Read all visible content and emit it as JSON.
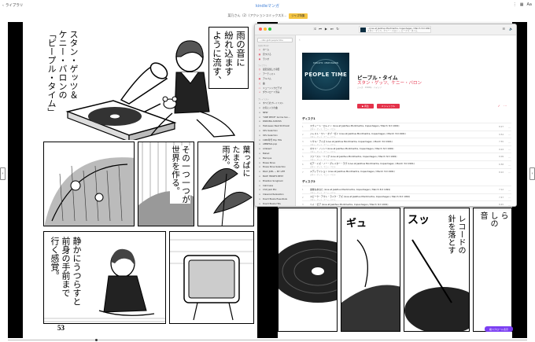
{
  "topbar": {
    "library_icon": "chevron-left-icon",
    "library_label": "ライブラリ",
    "brand": "kindleマンガ",
    "right_icons": [
      "vertical-dots-icon",
      "grid-icon",
      "font-size-icon"
    ],
    "font_label": "Aa"
  },
  "titlebar": {
    "book_title": "菜乃さん（2）(アクションコミックス)(...",
    "tag_label": "ジャズ特集"
  },
  "book": {
    "page_number": "53",
    "left_bubble_top": [
      "雨の音に",
      "紛れ込ます",
      "ように流す、"
    ],
    "left_bubble_caption": [
      "スタン・ゲッツ＆",
      "ケニー・バロンの",
      "「ピープル・タイム」"
    ],
    "mid_text_a": [
      "葉っぱに",
      "たまる",
      "雨水。"
    ],
    "mid_text_b": [
      "その一つ一つが",
      "世界を作る。"
    ],
    "low_text": [
      "静かにうつらすと",
      "前身の手前まで",
      "行く感覚。"
    ],
    "right_text_a": [
      "レコードの",
      "針を落とす"
    ],
    "right_text_b": [
      "ら",
      "しの",
      "音"
    ],
    "sfx_a": "ギュ",
    "sfx_b": "スッ",
    "view_button": "縦スクロール表示"
  },
  "music": {
    "transport": [
      "shuffle-icon",
      "prev-icon",
      "play-icon",
      "next-icon",
      "repeat-icon"
    ],
    "now_playing_line1": "...(Live at Jazzhus Montmartre, Copenhagen / March 3rd 1991) / ピープル・タイム",
    "now_playing_line2": "スタン・ゲッツ、ケニー・バロン — ピープル・タイム",
    "header_right": [
      "list-icon",
      "speaker-icon"
    ],
    "search_placeholder": "stan getz people time",
    "sidebar_sections": [
      {
        "title": "Apple Music",
        "items": [
          {
            "icon": "home-icon",
            "label": "ホーム"
          },
          {
            "icon": "browse-icon",
            "label": "見つける"
          },
          {
            "icon": "radio-icon",
            "label": "ラジオ"
          }
        ]
      },
      {
        "title": "ライブラリ",
        "items": [
          {
            "icon": "clock-icon",
            "label": "最近追加した項目"
          },
          {
            "icon": "mic-icon",
            "label": "アーティスト"
          },
          {
            "icon": "album-icon",
            "label": "アルバム"
          },
          {
            "icon": "note-icon",
            "label": "曲"
          },
          {
            "icon": "tv-icon",
            "label": "ミュージックビデオ"
          },
          {
            "icon": "download-icon",
            "label": "ダウンロード済み"
          }
        ]
      },
      {
        "title": "プレイリスト",
        "items": [
          {
            "icon": "playlist-icon",
            "label": "すべてのプレイリスト"
          },
          {
            "icon": "playlist-icon",
            "label": "お気に入りの曲"
          },
          {
            "icon": "playlist-icon",
            "label": "NEW"
          },
          {
            "icon": "playlist-icon",
            "label": "\"ONE PIECE\" Anime Son..."
          },
          {
            "icon": "playlist-icon",
            "label": "PARKING ACROSS"
          },
          {
            "icon": "playlist-icon",
            "label": "Halloween Best Shitmosh"
          },
          {
            "icon": "playlist-icon",
            "label": "90's Selection"
          },
          {
            "icon": "playlist-icon",
            "label": "90's Selection"
          },
          {
            "icon": "playlist-icon",
            "label": "1980年代 Pop Hits"
          },
          {
            "icon": "playlist-icon",
            "label": "AMNESIA-pop"
          },
          {
            "icon": "playlist-icon",
            "label": "Ambient"
          },
          {
            "icon": "playlist-icon",
            "label": "Ballad"
          },
          {
            "icon": "playlist-icon",
            "label": "Baroque"
          },
          {
            "icon": "playlist-icon",
            "label": "Bossa Nova"
          },
          {
            "icon": "playlist-icon",
            "label": "Bossa Nova Selection"
          },
          {
            "icon": "playlist-icon",
            "label": "BILLY JOEL ~ MY LIFE"
          },
          {
            "icon": "playlist-icon",
            "label": "BLUE HEARTS BEST"
          },
          {
            "icon": "playlist-icon",
            "label": "Brazilian Songbook"
          },
          {
            "icon": "playlist-icon",
            "label": "Calmness"
          },
          {
            "icon": "playlist-icon",
            "label": "Chill Jazz Mix"
          },
          {
            "icon": "playlist-icon",
            "label": "Classical Relaxation"
          },
          {
            "icon": "playlist-icon",
            "label": "David Bowie Essentials"
          },
          {
            "icon": "playlist-icon",
            "label": "David Bowie Hits"
          },
          {
            "icon": "playlist-icon",
            "label": "Early Music Essentials"
          },
          {
            "icon": "playlist-icon",
            "label": "Electric Love"
          }
        ]
      }
    ],
    "album": {
      "cover_title": "PEOPLE TIME",
      "cover_sub": "STAN GETZ · KENNY BARRON",
      "title": "ピープル・タイム",
      "artist": "スタン・ゲッツ、ケニー・バロン",
      "genre": "ジャズ · 1992年 · ハイレゾ",
      "play_label": "再生",
      "shuffle_label": "シャッフル",
      "right_icons": [
        "checkmark-icon",
        "more-icon"
      ]
    },
    "discs": [
      {
        "label": "ディスク1",
        "tracks": [
          {
            "n": "1",
            "title": "スウィート・ロレイン (Live at Jazzhus Montmartre, Copenhagen / March 3rd 1991)",
            "artist": "スタン・ゲッツ、ケニー・バロン",
            "dur": "8:27"
          },
          {
            "n": "2",
            "title": "ジャスト・ワン・オブ・ゼイ (Live at Jazzhus Montmartre, Copenhagen / March 3rd 1991)",
            "artist": "スタン・ゲッツ、ケニー・バロン",
            "dur": "9:54"
          },
          {
            "n": "3",
            "title": "ソウル・アイズ (Live at Jazzhus Montmartre, Copenhagen / March 3rd 1991)",
            "artist": "スタン・ゲッツ、ケニー・バロン",
            "dur": "7:55"
          },
          {
            "n": "4",
            "title": "ホワイ・ノット? (Live at Jazzhus Montmartre, Copenhagen / March 3rd 1991)",
            "artist": "スタン・ゲッツ、ケニー・バロン",
            "dur": "9:24"
          },
          {
            "n": "5",
            "title": "ファースト・ソング (Live at Jazzhus Montmartre, Copenhagen / March 3rd 1991)",
            "artist": "スタン・ゲッツ、ケニー・バロン",
            "dur": "9:09"
          },
          {
            "n": "6",
            "title": "ゼア・イズ・ノー・グレイター・ラヴ (Live at Jazzhus Montmartre, Copenhagen / March 3rd 1991)",
            "artist": "スタン・ゲッツ、ケニー・バロン",
            "dur": "6:58"
          },
          {
            "n": "7",
            "title": "メディテイション (Live at Jazzhus Montmartre, Copenhagen / March 3rd 1991)",
            "artist": "スタン・ゲッツ、ケニー・バロン",
            "dur": "8:22"
          }
        ]
      },
      {
        "label": "ディスク2",
        "tracks": [
          {
            "n": "1",
            "title": "素敵なあなた (Live at Jazzhus Montmartre, Copenhagen / March 3rd 1991)",
            "artist": "スタン・ゲッツ、ケニー・バロン",
            "dur": "7:12"
          },
          {
            "n": "2",
            "title": "スピーク・アウト・ライク・アズ (Live at Jazzhus Montmartre, Copenhagen / March 3rd 1991)",
            "artist": "スタン・ゲッツ、ケニー・バロン",
            "dur": "7:47"
          },
          {
            "n": "3",
            "title": "ヘイ・ゼア (Live at Jazzhus Montmartre, Copenhagen / March 3rd 1991)",
            "artist": "スタン・ゲッツ、ケニー・バロン",
            "dur": "8:45"
          },
          {
            "n": "4",
            "title": "ソー・ハード・ブレイン (Live at Jazzhus Montmartre, Copenhagen / March 3rd 1991)",
            "artist": "スタン・ゲッツ、ケニー・バロン",
            "dur": "7:14"
          }
        ]
      }
    ]
  },
  "colors": {
    "accent_red": "#e4324a",
    "kindle_blue": "#3a7bd5",
    "view_purple": "#7b3ff2"
  }
}
